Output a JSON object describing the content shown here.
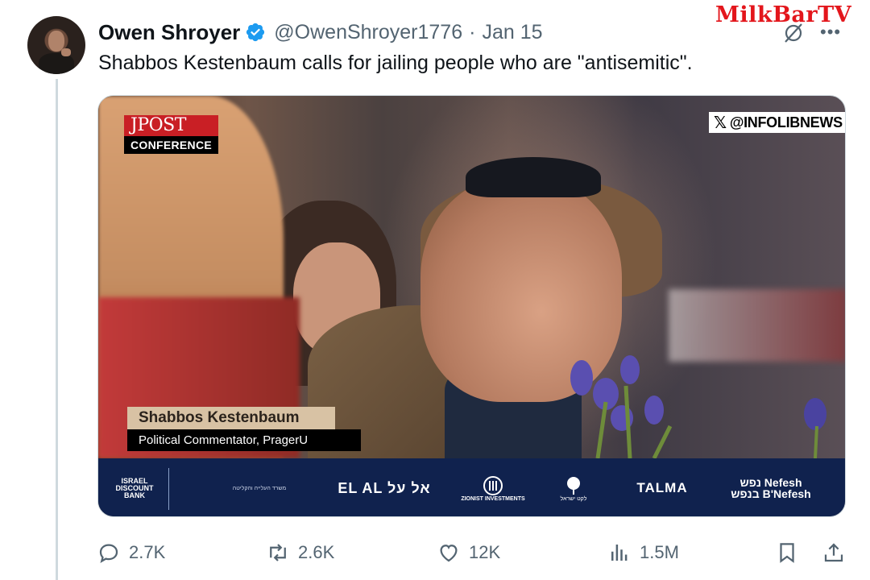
{
  "tweet": {
    "author_name": "Owen Shroyer",
    "handle": "@OwenShroyer1776",
    "separator": "·",
    "date": "Jan 15",
    "text": "Shabbos Kestenbaum calls for jailing people who are \"antisemitic\"."
  },
  "watermark": "MilkBarTV",
  "video": {
    "logo_top": "JPOST",
    "logo_bottom": "CONFERENCE",
    "credit_mark": "𝕏",
    "credit": "@INFOLIBNEWS",
    "lower_third_name": "Shabbos Kestenbaum",
    "lower_third_title": "Political Commentator, PragerU",
    "sponsors": {
      "israel_discount": "ISRAEL DISCOUNT BANK",
      "ministry": "משרד העלייה והקליטה",
      "elal": "EL AL אל על",
      "zionist": "ZIONIST INVESTMENTS",
      "leket": "לקט ישראל",
      "talma": "TALMA",
      "nefesh_top": "נפש Nefesh",
      "nefesh_bottom": "בנפש B'Nefesh"
    }
  },
  "actions": {
    "replies": "2.7K",
    "reposts": "2.6K",
    "likes": "12K",
    "views": "1.5M"
  },
  "colors": {
    "verified_blue": "#1d9bf0",
    "secondary_text": "#536471",
    "watermark_red": "#e3161c",
    "sponsor_bar": "#10224e"
  },
  "icons": [
    "verified-badge-icon",
    "grok-icon",
    "more-icon",
    "reply-icon",
    "repost-icon",
    "like-icon",
    "views-icon",
    "bookmark-icon",
    "share-icon"
  ]
}
